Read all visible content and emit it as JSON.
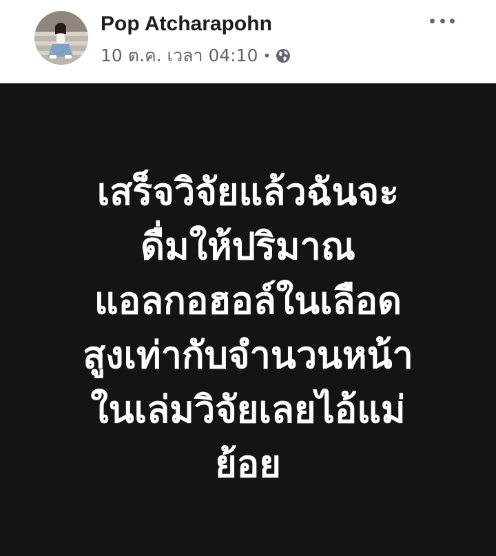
{
  "post": {
    "author": "Pop Atcharapohn",
    "timestamp": "10 ต.ค. เวลา 04:10",
    "separator": "•",
    "privacy_icon": "globe-icon",
    "more_icon": "more-dots-icon",
    "background_color": "#141414",
    "text_color": "#ffffff",
    "lines": [
      "เสร็จวิจัยแล้วฉันจะ",
      "ดื่มให้ปริมาณ",
      "แอลกอฮอล์ในเลือด",
      "สูงเท่ากับจำนวนหน้า",
      "ในเล่มวิจัยเลยไอ้แม่",
      "ย้อย"
    ]
  }
}
